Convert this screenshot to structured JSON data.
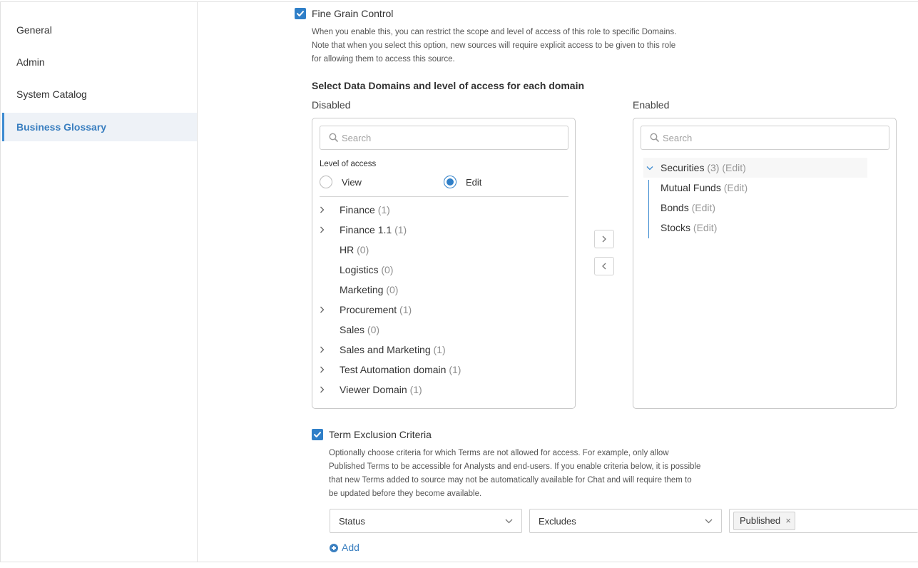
{
  "sidebar": {
    "items": [
      {
        "label": "General"
      },
      {
        "label": "Admin"
      },
      {
        "label": "System Catalog"
      },
      {
        "label": "Business Glossary",
        "active": true
      }
    ]
  },
  "fine_grain": {
    "checked": true,
    "label": "Fine Grain Control",
    "desc_lines": [
      "When you enable this, you can restrict the scope and level of access of this role to specific Domains.",
      "Note that when you select this option, new sources will require explicit access to be given to this role",
      "for allowing them to access this source."
    ]
  },
  "domains": {
    "heading": "Select Data Domains and level of access for each domain",
    "disabled_label": "Disabled",
    "enabled_label": "Enabled",
    "search_placeholder": "Search",
    "level_of_access_label": "Level of access",
    "view_label": "View",
    "edit_label": "Edit",
    "selected_level": "Edit",
    "disabled_items": [
      {
        "name": "Finance",
        "count": "(1)",
        "expandable": true
      },
      {
        "name": "Finance 1.1",
        "count": "(1)",
        "expandable": true
      },
      {
        "name": "HR",
        "count": "(0)",
        "expandable": false
      },
      {
        "name": "Logistics",
        "count": "(0)",
        "expandable": false
      },
      {
        "name": "Marketing",
        "count": "(0)",
        "expandable": false
      },
      {
        "name": "Procurement",
        "count": "(1)",
        "expandable": true
      },
      {
        "name": "Sales",
        "count": "(0)",
        "expandable": false
      },
      {
        "name": "Sales and Marketing",
        "count": "(1)",
        "expandable": true
      },
      {
        "name": "Test Automation domain",
        "count": "(1)",
        "expandable": true
      },
      {
        "name": "Viewer Domain",
        "count": "(1)",
        "expandable": true
      }
    ],
    "enabled_parent": {
      "name": "Securities",
      "count": "(3)",
      "edit": "(Edit)"
    },
    "enabled_children": [
      {
        "name": "Mutual Funds",
        "edit": "(Edit)"
      },
      {
        "name": "Bonds",
        "edit": "(Edit)"
      },
      {
        "name": "Stocks",
        "edit": "(Edit)"
      }
    ]
  },
  "term_exclusion": {
    "checked": true,
    "label": "Term Exclusion Criteria",
    "desc_lines": [
      "Optionally choose criteria for which Terms are not allowed for access. For example, only allow",
      "Published Terms to be accessible for Analysts and end-users. If you enable criteria below, it is possible",
      "that new Terms added to source may not be automatically available for Chat and will require them to",
      "be updated before they become available."
    ],
    "field_select": "Status",
    "operator_select": "Excludes",
    "value_tag": "Published",
    "tag_remove": "×",
    "add_label": "Add"
  },
  "colors": {
    "accent": "#2f7fc8",
    "link": "#3a7fc0",
    "sidebar_active_bg": "#eef2f7"
  }
}
